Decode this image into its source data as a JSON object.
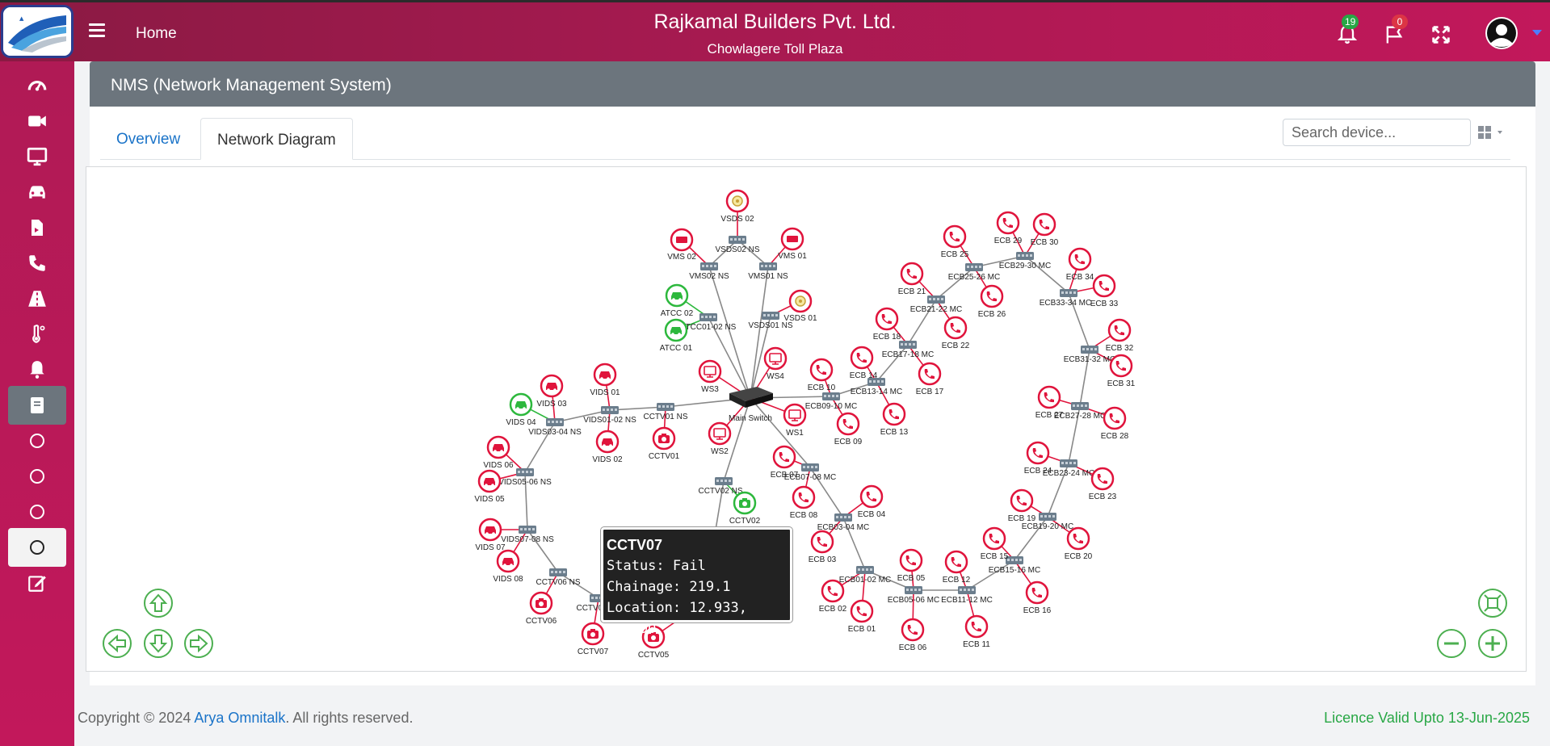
{
  "header": {
    "home_label": "Home",
    "company": "Rajkamal Builders Pvt. Ltd.",
    "plaza": "Chowlagere Toll Plaza",
    "notifications_count": "19",
    "flags_count": "0"
  },
  "sidebar": {
    "items": [
      "dashboard-icon",
      "video-camera-icon",
      "monitor-icon",
      "car-icon",
      "document-icon",
      "phone-icon",
      "road-icon",
      "temperature-icon",
      "bell-icon",
      "book-icon",
      "circle-icon",
      "circle-icon",
      "circle-icon",
      "circle-icon",
      "edit-icon"
    ]
  },
  "card": {
    "title": "NMS (Network Management System)"
  },
  "tabs": {
    "overview": "Overview",
    "network_diagram": "Network Diagram"
  },
  "search": {
    "placeholder": "Search device..."
  },
  "tooltip": {
    "title": "CCTV07",
    "status": "Status: Fail",
    "chainage": "Chainage: 219.1",
    "location": "Location: 12.933, 75.790"
  },
  "footer": {
    "copyright_prefix": "Copyright © 2024 ",
    "company_link": "Arya Omnitalk",
    "copyright_suffix": ". All rights reserved.",
    "licence": "Licence Valid Upto 13-Jun-2025"
  },
  "colors": {
    "fail": "#e0143c",
    "ok": "#2db83d",
    "switch": "#6b7d8c",
    "link": "#888888",
    "brand": "#c2185b"
  },
  "network": {
    "devices": [
      {
        "id": "VSDS 02",
        "type": "vsds",
        "status": "fail"
      },
      {
        "id": "VMS 02",
        "type": "vms",
        "status": "fail"
      },
      {
        "id": "VMS 01",
        "type": "vms",
        "status": "fail"
      },
      {
        "id": "VSDS 01",
        "type": "vsds",
        "status": "fail"
      },
      {
        "id": "ATCC 02",
        "type": "car",
        "status": "ok"
      },
      {
        "id": "ATCC 01",
        "type": "car",
        "status": "ok"
      },
      {
        "id": "WS3",
        "type": "ws",
        "status": "fail"
      },
      {
        "id": "WS4",
        "type": "ws",
        "status": "fail"
      },
      {
        "id": "WS1",
        "type": "ws",
        "status": "fail"
      },
      {
        "id": "WS2",
        "type": "ws",
        "status": "fail"
      },
      {
        "id": "VIDS 03",
        "type": "car",
        "status": "fail"
      },
      {
        "id": "VIDS 04",
        "type": "car",
        "status": "ok"
      },
      {
        "id": "VIDS 01",
        "type": "car",
        "status": "fail"
      },
      {
        "id": "VIDS 02",
        "type": "car",
        "status": "fail"
      },
      {
        "id": "VIDS 06",
        "type": "car",
        "status": "fail"
      },
      {
        "id": "VIDS 05",
        "type": "car",
        "status": "fail"
      },
      {
        "id": "VIDS 07",
        "type": "car",
        "status": "fail"
      },
      {
        "id": "VIDS 08",
        "type": "car",
        "status": "fail"
      },
      {
        "id": "CCTV01",
        "type": "cam",
        "status": "fail"
      },
      {
        "id": "CCTV02",
        "type": "cam",
        "status": "ok"
      },
      {
        "id": "CCTV06",
        "type": "cam",
        "status": "fail"
      },
      {
        "id": "CCTV07",
        "type": "cam",
        "status": "fail"
      },
      {
        "id": "CCTV05",
        "type": "cam",
        "status": "fail"
      },
      {
        "id": "ECB 10",
        "type": "phone",
        "status": "fail"
      },
      {
        "id": "ECB 09",
        "type": "phone",
        "status": "fail"
      },
      {
        "id": "ECB 14",
        "type": "phone",
        "status": "fail"
      },
      {
        "id": "ECB 13",
        "type": "phone",
        "status": "fail"
      },
      {
        "id": "ECB 18",
        "type": "phone",
        "status": "fail"
      },
      {
        "id": "ECB 17",
        "type": "phone",
        "status": "fail"
      },
      {
        "id": "ECB 21",
        "type": "phone",
        "status": "fail"
      },
      {
        "id": "ECB 22",
        "type": "phone",
        "status": "fail"
      },
      {
        "id": "ECB 25",
        "type": "phone",
        "status": "fail"
      },
      {
        "id": "ECB 26",
        "type": "phone",
        "status": "fail"
      },
      {
        "id": "ECB 29",
        "type": "phone",
        "status": "fail"
      },
      {
        "id": "ECB 30",
        "type": "phone",
        "status": "fail"
      },
      {
        "id": "ECB 34",
        "type": "phone",
        "status": "fail"
      },
      {
        "id": "ECB 33",
        "type": "phone",
        "status": "fail"
      },
      {
        "id": "ECB 32",
        "type": "phone",
        "status": "fail"
      },
      {
        "id": "ECB 31",
        "type": "phone",
        "status": "fail"
      },
      {
        "id": "ECB 27",
        "type": "phone",
        "status": "fail"
      },
      {
        "id": "ECB 28",
        "type": "phone",
        "status": "fail"
      },
      {
        "id": "ECB 24",
        "type": "phone",
        "status": "fail"
      },
      {
        "id": "ECB 23",
        "type": "phone",
        "status": "fail"
      },
      {
        "id": "ECB 19",
        "type": "phone",
        "status": "fail"
      },
      {
        "id": "ECB 20",
        "type": "phone",
        "status": "fail"
      },
      {
        "id": "ECB 15",
        "type": "phone",
        "status": "fail"
      },
      {
        "id": "ECB 16",
        "type": "phone",
        "status": "fail"
      },
      {
        "id": "ECB 12",
        "type": "phone",
        "status": "fail"
      },
      {
        "id": "ECB 11",
        "type": "phone",
        "status": "fail"
      },
      {
        "id": "ECB 05",
        "type": "phone",
        "status": "fail"
      },
      {
        "id": "ECB 06",
        "type": "phone",
        "status": "fail"
      },
      {
        "id": "ECB 02",
        "type": "phone",
        "status": "fail"
      },
      {
        "id": "ECB 01",
        "type": "phone",
        "status": "fail"
      },
      {
        "id": "ECB 03",
        "type": "phone",
        "status": "fail"
      },
      {
        "id": "ECB 04",
        "type": "phone",
        "status": "fail"
      },
      {
        "id": "ECB 07",
        "type": "phone",
        "status": "fail"
      },
      {
        "id": "ECB 08",
        "type": "phone",
        "status": "fail"
      }
    ],
    "switches": [
      "Main Switch",
      "VSDS02 NS",
      "VMS02 NS",
      "VMS01 NS",
      "ATCC01-02 NS",
      "VSDS01 NS",
      "CCTV01 NS",
      "VIDS01-02 NS",
      "VIDS03-04 NS",
      "VIDS05-06 NS",
      "VIDS07-08 NS",
      "CCTV06 NS",
      "CCTV07 NS",
      "CCTV02 NS",
      "CCTV04",
      "ECB09-10 MC",
      "ECB13-14 MC",
      "ECB17-18 MC",
      "ECB21-22 MC",
      "ECB25-26 MC",
      "ECB29-30 MC",
      "ECB33-34 MC",
      "ECB31-32 MC",
      "ECB27-28 MC",
      "ECB23-24 MC",
      "ECB19-20 MC",
      "ECB15-16 MC",
      "ECB11-12 MC",
      "ECB05-06 MC",
      "ECB01-02 MC",
      "ECB03-04 MC",
      "ECB07-08 MC"
    ]
  }
}
